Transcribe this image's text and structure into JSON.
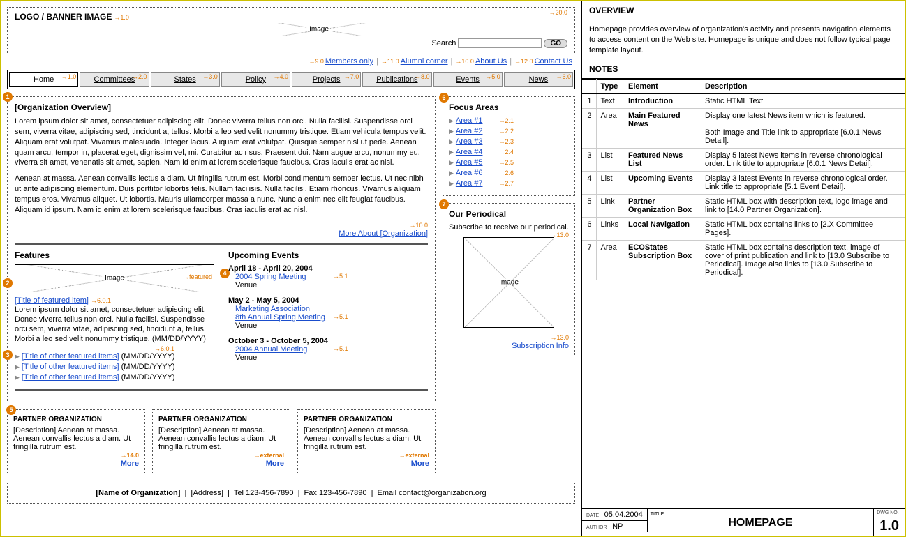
{
  "banner": {
    "title": "LOGO / BANNER IMAGE",
    "img_label": "Image",
    "ref": "1.0",
    "search_label": "Search",
    "search_ref": "20.0",
    "go": "GO"
  },
  "toplinks": {
    "items": [
      {
        "label": "Members only",
        "ref": "9.0"
      },
      {
        "label": "Alumni corner",
        "ref": "11.0"
      },
      {
        "label": "About Us",
        "ref": "10.0"
      },
      {
        "label": "Contact Us",
        "ref": "12.0"
      }
    ]
  },
  "nav": [
    {
      "label": "Home",
      "ref": "1.0",
      "active": true
    },
    {
      "label": "Committees",
      "ref": "2.0"
    },
    {
      "label": "States",
      "ref": "3.0"
    },
    {
      "label": "Policy",
      "ref": "4.0"
    },
    {
      "label": "Projects",
      "ref": "7.0"
    },
    {
      "label": "Publications",
      "ref": "8.0"
    },
    {
      "label": "Events",
      "ref": "5.0"
    },
    {
      "label": "News",
      "ref": "6.0"
    }
  ],
  "overview": {
    "heading": "[Organization Overview]",
    "p1": "Lorem ipsum dolor sit amet, consectetuer adipiscing elit. Donec viverra tellus non orci. Nulla facilisi. Suspendisse orci sem, viverra vitae, adipiscing sed, tincidunt a, tellus. Morbi a leo sed velit nonummy tristique. Etiam vehicula tempus velit. Aliquam erat volutpat. Vivamus malesuada. Integer lacus. Aliquam erat volutpat. Quisque semper nisl ut pede. Aenean quam arcu, tempor in, placerat eget, dignissim vel, mi. Curabitur ac risus. Praesent dui. Nam augue arcu, nonummy eu, viverra sit amet, venenatis sit amet, sapien. Nam id enim at lorem scelerisque faucibus. Cras iaculis erat ac nisl.",
    "p2": "Aenean at massa. Aenean convallis lectus a diam. Ut fringilla rutrum est. Morbi condimentum semper lectus. Ut nec nibh ut ante adipiscing elementum. Duis porttitor lobortis felis. Nullam facilisis. Nulla facilisi. Etiam rhoncus. Vivamus aliquam tempus eros. Vivamus aliquet. Ut lobortis. Mauris ullamcorper massa a nunc. Nunc a enim nec elit feugiat faucibus. Aliquam id ipsum. Nam id enim at lorem scelerisque faucibus. Cras iaculis erat ac nisl.",
    "more": "More About [Organization]",
    "more_ref": "10.0"
  },
  "features": {
    "heading": "Features",
    "img_label": "Image",
    "img_ref": "featured",
    "title": "[Title of featured item]",
    "title_ref": "6.0.1",
    "desc": "Lorem ipsum dolor sit amet, consectetuer adipiscing elit. Donec viverra tellus non orci. Nulla facilisi. Suspendisse orci sem, viverra vitae, adipiscing sed, tincidunt a, tellus. Morbi a leo sed velit nonummy tristique. (MM/DD/YYYY)",
    "others_ref": "6.0.1",
    "others": [
      {
        "title": "[Title of other featured items]",
        "date": "(MM/DD/YYYY)"
      },
      {
        "title": "[Title of other featured items]",
        "date": "(MM/DD/YYYY)"
      },
      {
        "title": "[Title of other featured items]",
        "date": "(MM/DD/YYYY)"
      }
    ]
  },
  "events": {
    "heading": "Upcoming Events",
    "items": [
      {
        "date": "April 18 - April 20, 2004",
        "links": [
          "2004 Spring Meeting"
        ],
        "venue": "Venue",
        "ref": "5.1"
      },
      {
        "date": "May 2 - May 5, 2004",
        "links": [
          "Marketing Association",
          "8th Annual Spring Meeting"
        ],
        "venue": "Venue",
        "ref": "5.1"
      },
      {
        "date": "October 3 - October 5, 2004",
        "links": [
          "2004 Annual Meeting"
        ],
        "venue": "Venue",
        "ref": "5.1"
      }
    ]
  },
  "partners": {
    "title": "PARTNER ORGANIZATION",
    "desc": "[Description] Aenean at massa. Aenean convallis lectus a diam. Ut fringilla rutrum est.",
    "more": "More",
    "refs": [
      "14.0",
      "external",
      "external"
    ]
  },
  "focus": {
    "heading": "Focus Areas",
    "items": [
      {
        "label": "Area #1",
        "ref": "2.1"
      },
      {
        "label": "Area #2",
        "ref": "2.2"
      },
      {
        "label": "Area #3",
        "ref": "2.3"
      },
      {
        "label": "Area #4",
        "ref": "2.4"
      },
      {
        "label": "Area #5",
        "ref": "2.5"
      },
      {
        "label": "Area #6",
        "ref": "2.6"
      },
      {
        "label": "Area #7",
        "ref": "2.7"
      }
    ]
  },
  "periodical": {
    "heading": "Our Periodical",
    "desc": "Subscribe to receive our periodical.",
    "img_label": "Image",
    "img_ref": "13.0",
    "sub": "Subscription Info",
    "sub_ref": "13.0"
  },
  "footer": {
    "org": "[Name of Organization]",
    "addr": "[Address]",
    "tel": "Tel 123-456-7890",
    "fax": "Fax 123-456-7890",
    "email": "Email contact@organization.org"
  },
  "sb_overview": {
    "heading": "OVERVIEW",
    "text": "Homepage provides overview of organization's activity and presents navigation elements to access content on the Web site. Homepage is unique and does not follow typical page template layout."
  },
  "notes": {
    "heading": "NOTES",
    "cols": [
      "",
      "Type",
      "Element",
      "Description"
    ],
    "rows": [
      {
        "n": "1",
        "type": "Text",
        "el": "Introduction",
        "desc": "Static HTML Text"
      },
      {
        "n": "2",
        "type": "Area",
        "el": "Main Featured News",
        "desc": "Display one latest News item which is featured.\n\nBoth Image and Title link to appropriate [6.0.1 News Detail]."
      },
      {
        "n": "3",
        "type": "List",
        "el": "Featured News List",
        "desc": "Display 5 latest News items in reverse chronological order. Link title to appropriate [6.0.1 News Detail]."
      },
      {
        "n": "4",
        "type": "List",
        "el": "Upcoming Events",
        "desc": "Display 3 latest Events in reverse chronological order. Link title to appropriate [5.1 Event Detail]."
      },
      {
        "n": "5",
        "type": "Link",
        "el": "Partner Organization Box",
        "desc": "Static HTML box with description text, logo image and link to [14.0 Partner Organization]."
      },
      {
        "n": "6",
        "type": "Links",
        "el": "Local Navigation",
        "desc": "Static HTML box contains links to [2.X Committee Pages]."
      },
      {
        "n": "7",
        "type": "Area",
        "el": "ECOStates Subscription Box",
        "desc": "Static HTML box contains description text, image of cover of print publication and link to [13.0 Subscribe to Periodical]. Image also links to [13.0 Subscribe to Periodical]."
      }
    ]
  },
  "meta": {
    "date_label": "DATE",
    "date": "05.04.2004",
    "title_label": "TITLE",
    "title": "HOMEPAGE",
    "author_label": "AUTHOR",
    "author": "NP",
    "dwg_label": "DWG NO.",
    "dwg": "1.0"
  }
}
